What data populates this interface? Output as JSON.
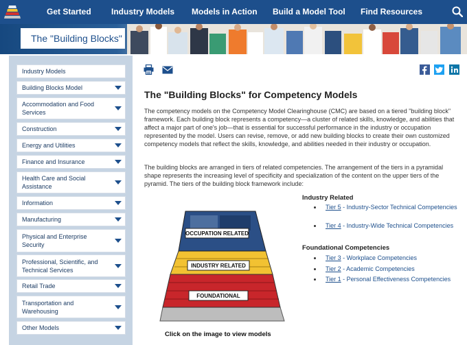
{
  "nav": {
    "items": [
      "Get Started",
      "Industry Models",
      "Models in Action",
      "Build a Model Tool",
      "Find Resources"
    ],
    "logo_icon": "stacked-bars-logo-icon",
    "search_icon": "search-icon",
    "bg_color": "#1d4f8c"
  },
  "banner": {
    "title": "The \"Building Blocks\""
  },
  "sidebar": {
    "items": [
      {
        "label": "Industry Models",
        "chevron": false
      },
      {
        "label": "Building Blocks Model",
        "chevron": true
      },
      {
        "label": "Accommodation and Food Services",
        "chevron": true
      },
      {
        "label": "Construction",
        "chevron": true
      },
      {
        "label": "Energy and Utilities",
        "chevron": true
      },
      {
        "label": "Finance and Insurance",
        "chevron": true
      },
      {
        "label": "Health Care and Social Assistance",
        "chevron": true
      },
      {
        "label": "Information",
        "chevron": true
      },
      {
        "label": "Manufacturing",
        "chevron": true
      },
      {
        "label": "Physical and Enterprise Security",
        "chevron": true
      },
      {
        "label": "Professional, Scientific, and Technical Services",
        "chevron": true
      },
      {
        "label": "Retail Trade",
        "chevron": true
      },
      {
        "label": "Transportation and Warehousing",
        "chevron": true
      },
      {
        "label": "Other Models",
        "chevron": true
      }
    ]
  },
  "tools": {
    "print_icon": "print-icon",
    "email_icon": "email-icon"
  },
  "share": {
    "facebook": "facebook-icon",
    "twitter": "twitter-icon",
    "linkedin": "linkedin-icon"
  },
  "main": {
    "title": "The \"Building Blocks\" for Competency Models",
    "para1": "The competency models on the Competency Model Clearinghouse (CMC) are based on a tiered \"building block\" framework. Each building block represents a competency—a cluster of related skills, knowledge, and abilities that affect a major part of one's job—that is essential for successful performance in the industry or occupation represented by the model. Users can revise, remove, or add new building blocks to create their own customized competency models that reflect the skills, knowledge, and abilities needed in their industry or occupation.",
    "para2": "The building blocks are arranged in tiers of related competencies. The arrangement of the tiers in a pyramidal shape represents the increasing level of specificity and specialization of the content on the upper tiers of the pyramid. The tiers of the building block framework include:",
    "pyramid": {
      "labels": [
        "OCCUPATION RELATED",
        "INDUSTRY RELATED",
        "FOUNDATIONAL"
      ],
      "colors": {
        "top": "#2b4f86",
        "middle": "#f2c232",
        "bottom": "#c8262b",
        "base": "#bdbdbd"
      }
    },
    "caption": "Click on the image to view models",
    "groups": [
      {
        "heading": "Industry Related",
        "items": [
          {
            "link": "Tier 5",
            "text": " - Industry-Sector Technical Competencies"
          },
          {
            "link": "Tier 4",
            "text": " - Industry-Wide Technical Competencies"
          }
        ]
      },
      {
        "heading": "Foundational Competencies",
        "items": [
          {
            "link": "Tier 3",
            "text": " - Workplace Competencies"
          },
          {
            "link": "Tier 2",
            "text": " - Academic Competencies"
          },
          {
            "link": "Tier 1",
            "text": " - Personal Effectiveness Competencies"
          }
        ]
      }
    ]
  }
}
